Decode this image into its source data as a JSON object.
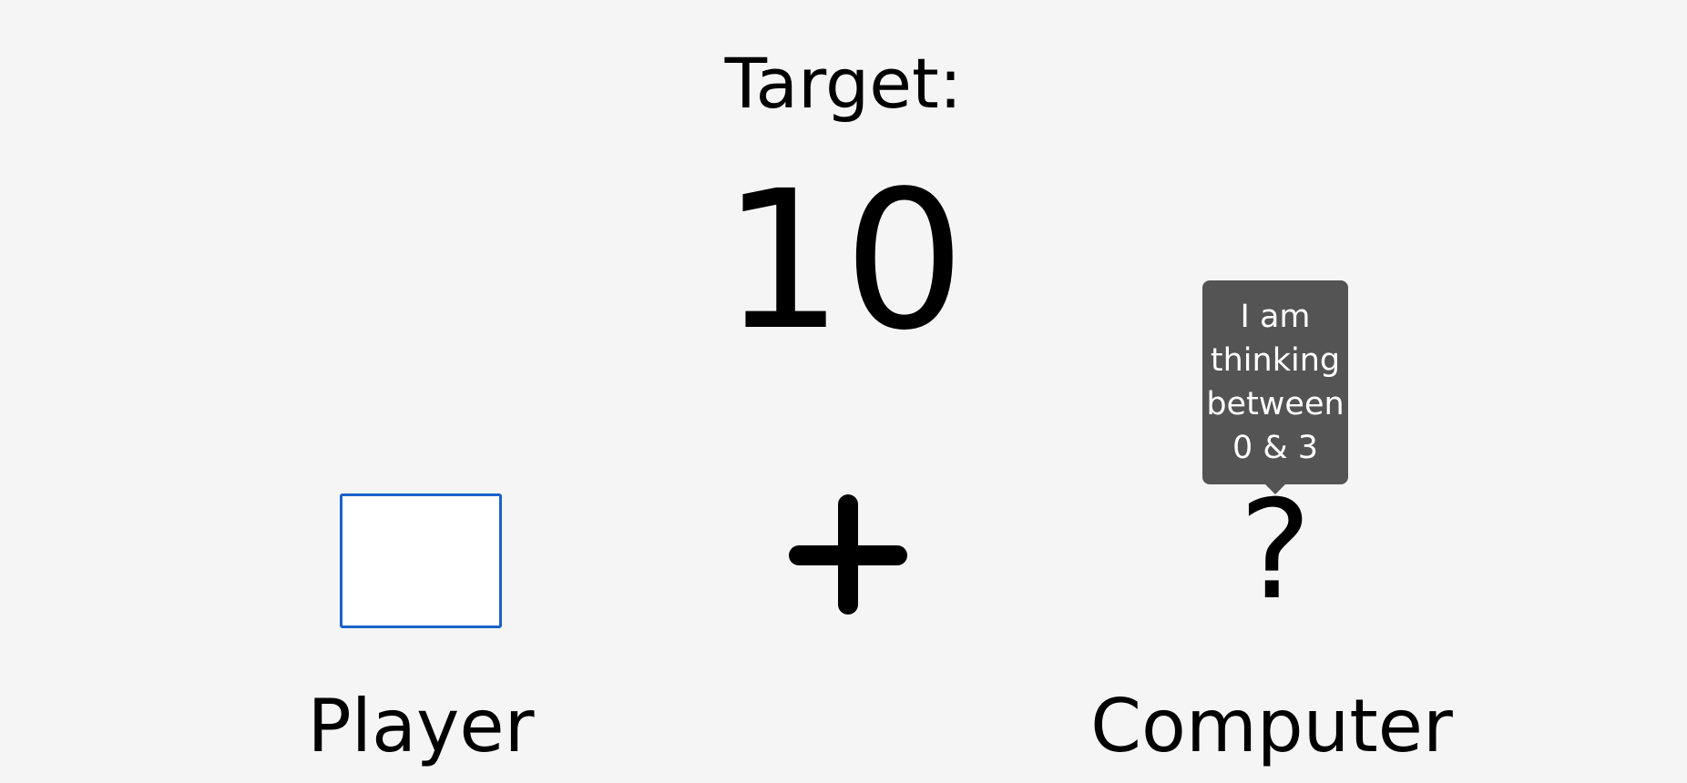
{
  "target": {
    "label": "Target:",
    "value": "10"
  },
  "player": {
    "input_value": "",
    "label": "Player"
  },
  "operator": {
    "icon": "plus-icon"
  },
  "computer": {
    "mystery_value": "?",
    "hint": "I am thinking between 0 & 3",
    "label": "Computer"
  },
  "colors": {
    "background": "#f5f5f5",
    "input_focus_border": "#1a62c9",
    "tooltip_background": "#545454",
    "tooltip_text": "#ffffff"
  }
}
